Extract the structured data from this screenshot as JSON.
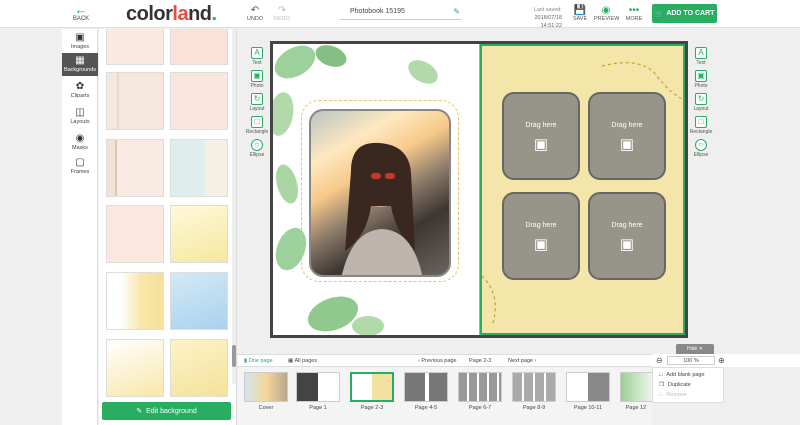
{
  "topbar": {
    "back_label": "BACK",
    "logo": {
      "part1": "color",
      "part2": "la",
      "part3": "nd",
      "dot": "."
    },
    "undo_label": "UNDO",
    "redo_label": "REDO",
    "project_title": "Photobook 15195",
    "last_saved_label": "Last saved:",
    "last_saved_value": "2018/07/18 14:51:22",
    "save_label": "SAVE",
    "preview_label": "PREVIEW",
    "more_label": "MORE",
    "cart_label": "ADD TO CART"
  },
  "left_tools": [
    {
      "label": "Images",
      "icon": "image-icon"
    },
    {
      "label": "Backgrounds",
      "icon": "background-icon",
      "active": true
    },
    {
      "label": "Cliparts",
      "icon": "clipart-icon"
    },
    {
      "label": "Layouts",
      "icon": "layout-icon"
    },
    {
      "label": "Masks",
      "icon": "mask-icon"
    },
    {
      "label": "Frames",
      "icon": "frame-icon"
    }
  ],
  "panel": {
    "edit_background_label": "Edit background"
  },
  "side_tools": {
    "text": "Text",
    "photo": "Photo",
    "layout": "Layout",
    "rectangle": "Rectangle",
    "ellipse": "Ellipse"
  },
  "drop_zones": [
    "Drag here",
    "Drag here",
    "Drag here",
    "Drag here"
  ],
  "pages_bar": {
    "one_page": "One page",
    "all_pages": "All pages",
    "previous_page": "Previous page",
    "current": "Page 2-3",
    "next_page": "Next page",
    "hide": "Hide",
    "zoom": "100 %"
  },
  "page_strip": [
    "Cover",
    "Page 1",
    "Page 2-3",
    "Page 4-5",
    "Page 6-7",
    "Page 8-9",
    "Page 10-11",
    "Page 12"
  ],
  "context_menu": {
    "add_blank_page": "Add blank page",
    "duplicate": "Duplicate",
    "remove": "Remove"
  },
  "colors": {
    "accent": "#27ae60",
    "logo_red": "#e74c3c"
  }
}
